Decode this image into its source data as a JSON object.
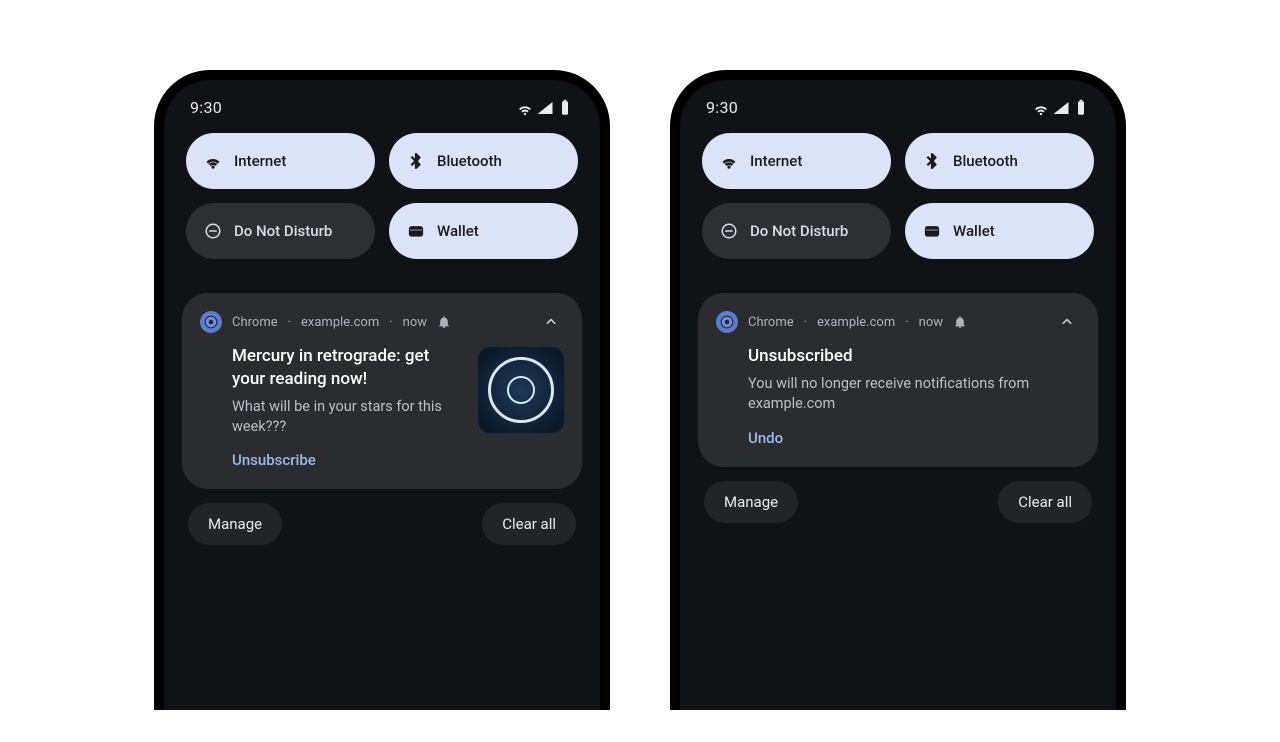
{
  "status": {
    "time": "9:30"
  },
  "qs": {
    "internet": {
      "label": "Internet",
      "active": true
    },
    "bluetooth": {
      "label": "Bluetooth",
      "active": true
    },
    "dnd": {
      "label": "Do Not Disturb",
      "active": false
    },
    "wallet": {
      "label": "Wallet",
      "active": true
    }
  },
  "notif_header": {
    "app": "Chrome",
    "site": "example.com",
    "when": "now"
  },
  "phone1": {
    "notif": {
      "title": "Mercury in retrograde: get your reading now!",
      "body": "What will be in your stars for this week???",
      "action": "Unsubscribe"
    }
  },
  "phone2": {
    "notif": {
      "title": "Unsubscribed",
      "body": "You will no longer receive notifications from example.com",
      "action": "Undo"
    }
  },
  "shade": {
    "manage": "Manage",
    "clear_all": "Clear all"
  }
}
